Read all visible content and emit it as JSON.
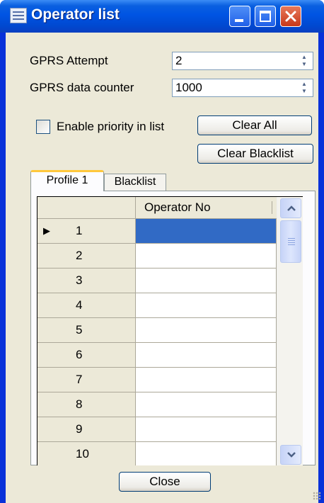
{
  "window": {
    "title": "Operator list"
  },
  "settings": {
    "gprs_attempt_label": "GPRS Attempt",
    "gprs_attempt_value": "2",
    "gprs_counter_label": "GPRS data counter",
    "gprs_counter_value": "1000",
    "priority_label": "Enable priority in list",
    "priority_checked": false
  },
  "buttons": {
    "clear_all": "Clear All",
    "clear_blacklist": "Clear Blacklist",
    "close": "Close"
  },
  "tabs": [
    {
      "label": "Profile 1",
      "active": true
    },
    {
      "label": "Blacklist",
      "active": false
    }
  ],
  "grid": {
    "column_header": "Operator No",
    "rows": [
      "1",
      "2",
      "3",
      "4",
      "5",
      "6",
      "7",
      "8",
      "9",
      "10"
    ],
    "selected_row": "1"
  }
}
